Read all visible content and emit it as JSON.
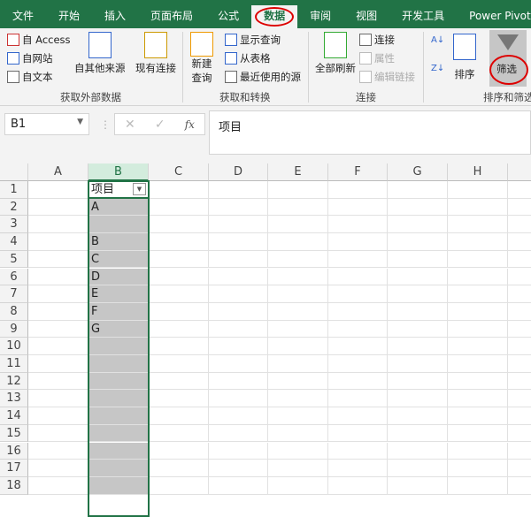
{
  "tabs": [
    "文件",
    "开始",
    "插入",
    "页面布局",
    "公式",
    "数据",
    "审阅",
    "视图",
    "开发工具",
    "Power Pivot"
  ],
  "active_tab": "数据",
  "ribbon": {
    "get_external": {
      "access": "自 Access",
      "web": "自网站",
      "text": "自文本",
      "other": "自其他来源",
      "existing": "现有连接",
      "label": "获取外部数据"
    },
    "transform": {
      "new_query": "新建",
      "new_query2": "查询",
      "show_query": "显示查询",
      "from_table": "从表格",
      "recent": "最近使用的源",
      "label": "获取和转换"
    },
    "connections": {
      "refresh": "全部刷新",
      "connections": "连接",
      "properties": "属性",
      "edit_links": "编辑链接",
      "label": "连接"
    },
    "sort_filter": {
      "sort": "排序",
      "filter": "筛选",
      "label": "排序和筛选"
    }
  },
  "formula_bar": {
    "name_box": "B1",
    "content": "项目",
    "fx": "fx"
  },
  "columns": [
    "A",
    "B",
    "C",
    "D",
    "E",
    "F",
    "G",
    "H"
  ],
  "rows": [
    "1",
    "2",
    "3",
    "4",
    "5",
    "6",
    "7",
    "8",
    "9",
    "10",
    "11",
    "12",
    "13",
    "14",
    "15",
    "16",
    "17",
    "18"
  ],
  "column_b": [
    "项目",
    "A",
    "",
    "B",
    "C",
    "D",
    "E",
    "F",
    "G"
  ]
}
